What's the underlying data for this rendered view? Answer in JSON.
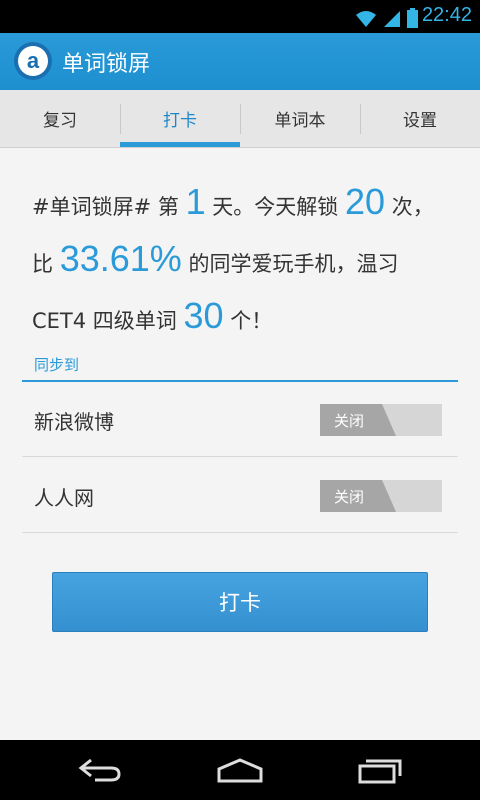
{
  "status_bar": {
    "time": "22:42"
  },
  "app": {
    "title": "单词锁屏",
    "logo_letter": "a"
  },
  "tabs": [
    {
      "label": "复习"
    },
    {
      "label": "打卡"
    },
    {
      "label": "单词本"
    },
    {
      "label": "设置"
    }
  ],
  "summary": {
    "t1": "#单词锁屏# 第",
    "days": "1",
    "t2": "天。今天解锁",
    "unlocks": "20",
    "t3": "次，比",
    "percent": "33.61%",
    "t4": "的同学爱玩手机，温习CET4 四级单词",
    "words": "30",
    "t5": "个！"
  },
  "sync": {
    "label": "同步到",
    "items": [
      {
        "label": "新浪微博",
        "toggle": "关闭"
      },
      {
        "label": "人人网",
        "toggle": "关闭"
      }
    ]
  },
  "checkin_button": "打卡",
  "colors": {
    "accent": "#2a9ad8",
    "action_bar": "#2196d3"
  }
}
